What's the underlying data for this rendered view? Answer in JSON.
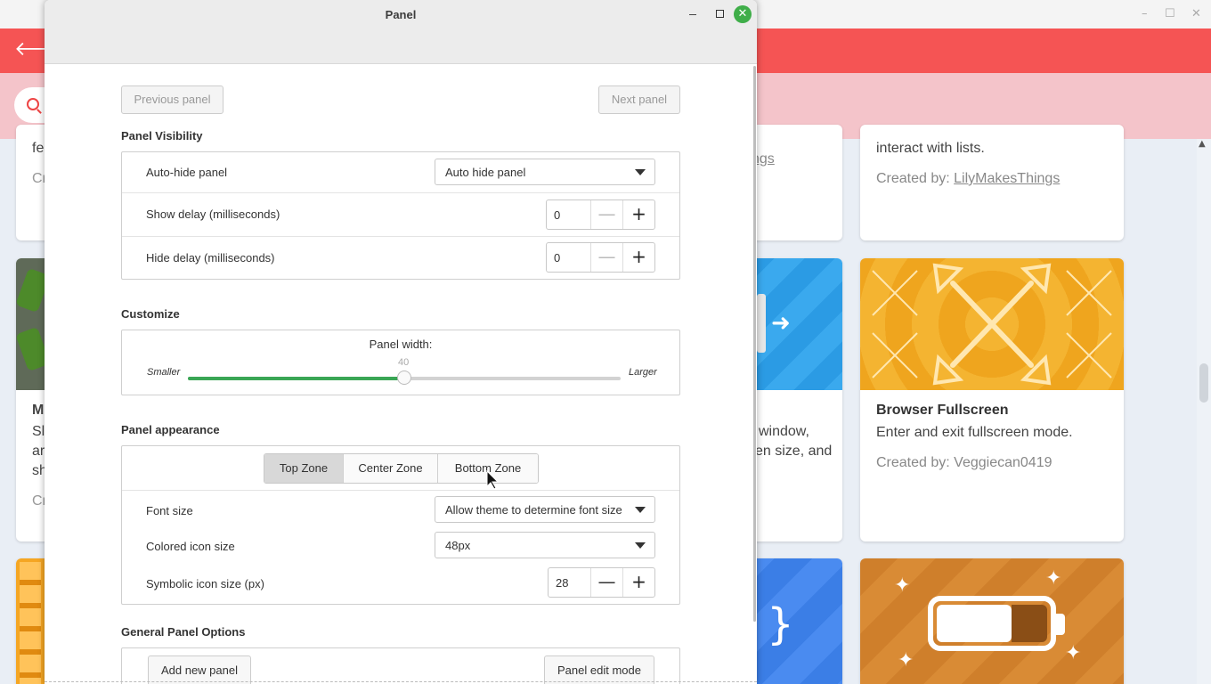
{
  "background": {
    "search_placeholder": "",
    "cards": [
      {
        "desc": "interact with lists.",
        "by_label": "Created by: ",
        "by_author": "LilyMakesThings"
      },
      {
        "title": "Browser Fullscreen",
        "desc": "Enter and exit fullscreen mode.",
        "by_label": "Created by: ",
        "by_author": "Veggiecan0419"
      }
    ],
    "fragments": {
      "left_top_1": "fe",
      "left_top_2": "Cr",
      "left_mid_title": "M",
      "left_mid_1": "Sl",
      "left_mid_2": "ar",
      "left_mid_3": "sh",
      "left_mid_4": "Cr",
      "mid_top_link": "ngs",
      "mid_desc_1": "window,",
      "mid_desc_2": "en size, and"
    }
  },
  "dialog": {
    "title": "Panel",
    "nav": {
      "previous": "Previous panel",
      "next": "Next panel"
    },
    "visibility": {
      "title": "Panel Visibility",
      "autohide_label": "Auto-hide panel",
      "autohide_value": "Auto hide panel",
      "show_delay_label": "Show delay (milliseconds)",
      "show_delay_value": "0",
      "hide_delay_label": "Hide delay (milliseconds)",
      "hide_delay_value": "0"
    },
    "customize": {
      "title": "Customize",
      "width_label": "Panel width:",
      "min_label": "Smaller",
      "max_label": "Larger",
      "value": "40",
      "fraction": 0.5
    },
    "appearance": {
      "title": "Panel appearance",
      "zones": [
        "Top Zone",
        "Center Zone",
        "Bottom Zone"
      ],
      "active_zone": 0,
      "font_size_label": "Font size",
      "font_size_value": "Allow theme to determine font size",
      "colored_icon_label": "Colored icon size",
      "colored_icon_value": "48px",
      "symbolic_icon_label": "Symbolic icon size (px)",
      "symbolic_icon_value": "28"
    },
    "general": {
      "title": "General Panel Options",
      "add_panel": "Add new panel",
      "edit_mode": "Panel edit mode"
    },
    "minus_symbol": "—",
    "plus_symbol": "+"
  }
}
